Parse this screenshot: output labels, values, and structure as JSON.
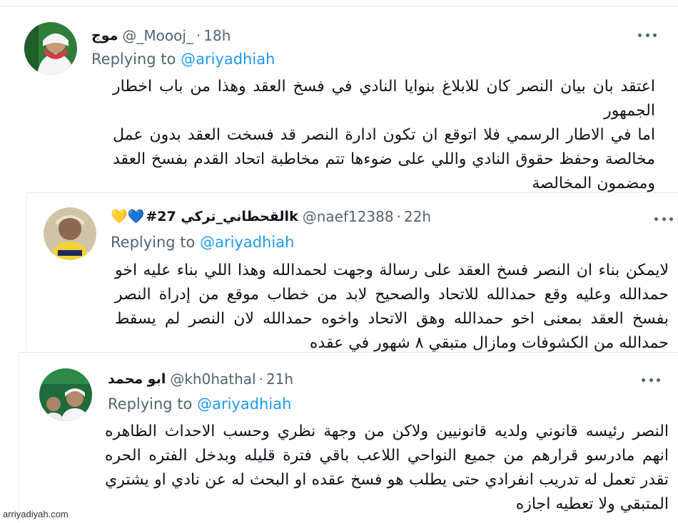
{
  "tweets": [
    {
      "name": "موج",
      "handle": "@_Moooj_",
      "dot": "·",
      "time": "18h",
      "replying_prefix": "Replying to",
      "replying_to": "@ariyadhiah",
      "lines": [
        "اعتقد بان بيان النصر كان للابلاغ بنوايا النادي في فسخ العقد وهذا من باب اخطار الجمهور",
        "اما في الاطار الرسمي فلا اتوقع ان تكون ادارة النصر قد فسخت العقد بدون عمل مخالصة وحفظ حقوق النادي واللي على ضوءها تتم مخاطبة اتحاد القدم بفسخ العقد ومضمون المخالصة"
      ],
      "avatar_icon": "profile-photo"
    },
    {
      "name": "#القحطاني_تركي 27k",
      "name_emojis": "💛💙",
      "handle": "@naef12388",
      "dot": "·",
      "time": "22h",
      "replying_prefix": "Replying to",
      "replying_to": "@ariyadhiah",
      "lines": [
        "لايمكن بناء ان النصر فسخ العقد على رسالة وجهت لحمدالله وهذا اللي بناء عليه اخو حمدالله وعليه وقع حمدالله للاتحاد والصحيح لابد من خطاب موقع من إدراة النصر بفسخ العقد بمعنى اخو حمدالله وهق الاتحاد واخوه حمدالله لان النصر لم يسقط حمدالله من الكشوفات ومازال متبقي ٨ شهور في عقده"
      ],
      "avatar_icon": "profile-photo"
    },
    {
      "name": "ابو محمد",
      "handle": "@kh0hathal",
      "dot": "·",
      "time": "21h",
      "replying_prefix": "Replying to",
      "replying_to": "@ariyadhiah",
      "lines": [
        "النصر رئيسه قانوني ولديه قانونيين ولاكن من وجهة نظري وحسب الاحداث الظاهره انهم مادرسو قرارهم من جميع النواحي اللاعب باقي فترة قليله وبدخل الفتره الحره تقدر تعمل له تدريب انفرادي حتى يطلب هو فسخ عقده او البحث له عن نادي او يشتري المتبقي ولا تعطيه اجازه"
      ],
      "avatar_icon": "profile-photo"
    }
  ],
  "watermark": "arriyadiyah.com",
  "colors": {
    "accent": "#1d9bf0",
    "secondary": "#536471",
    "text": "#0f1419"
  }
}
